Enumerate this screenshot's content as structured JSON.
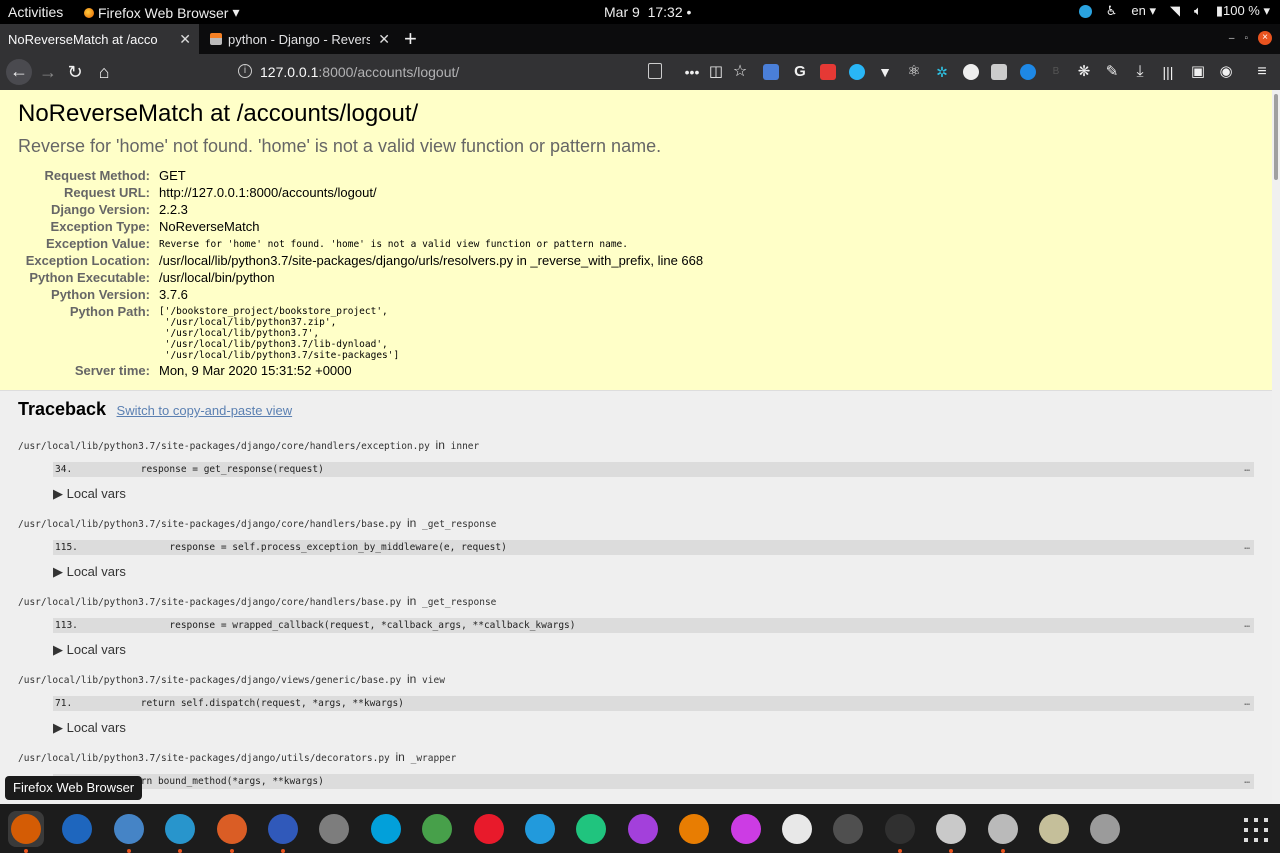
{
  "topbar": {
    "activities": "Activities",
    "app_name": "Firefox Web Browser",
    "date": "Mar 9",
    "time": "17:32",
    "language": "en",
    "battery": "100 %"
  },
  "tabs": [
    {
      "title": "NoReverseMatch at /accounts/logout/",
      "active": true
    },
    {
      "title": "python - Django - Reverse for 'home' not found",
      "active": false
    }
  ],
  "navbar": {
    "url_host": "127.0.0.1",
    "url_rest": ":8000/accounts/logout/"
  },
  "error": {
    "title": "NoReverseMatch at /accounts/logout/",
    "subtitle": "Reverse for 'home' not found. 'home' is not a valid view function or pattern name.",
    "meta": [
      {
        "label": "Request Method:",
        "value": "GET"
      },
      {
        "label": "Request URL:",
        "value": "http://127.0.0.1:8000/accounts/logout/"
      },
      {
        "label": "Django Version:",
        "value": "2.2.3"
      },
      {
        "label": "Exception Type:",
        "value": "NoReverseMatch"
      },
      {
        "label": "Exception Value:",
        "value": "Reverse for 'home' not found. 'home' is not a valid view function or pattern name."
      },
      {
        "label": "Exception Location:",
        "value": "/usr/local/lib/python3.7/site-packages/django/urls/resolvers.py in _reverse_with_prefix, line 668"
      },
      {
        "label": "Python Executable:",
        "value": "/usr/local/bin/python"
      },
      {
        "label": "Python Version:",
        "value": "3.7.6"
      },
      {
        "label": "Python Path:",
        "value": "['/bookstore_project/bookstore_project',\n '/usr/local/lib/python37.zip',\n '/usr/local/lib/python3.7',\n '/usr/local/lib/python3.7/lib-dynload',\n '/usr/local/lib/python3.7/site-packages']"
      },
      {
        "label": "Server time:",
        "value": "Mon, 9 Mar 2020 15:31:52 +0000"
      }
    ]
  },
  "traceback": {
    "heading": "Traceback",
    "toggle": "Switch to copy-and-paste view",
    "in_word": "in",
    "local_vars": "▶ Local vars",
    "frames": [
      {
        "file": "/usr/local/lib/python3.7/site-packages/django/core/handlers/exception.py",
        "func": "inner",
        "line": "34.            response = get_response(request)"
      },
      {
        "file": "/usr/local/lib/python3.7/site-packages/django/core/handlers/base.py",
        "func": "_get_response",
        "line": "115.                response = self.process_exception_by_middleware(e, request)"
      },
      {
        "file": "/usr/local/lib/python3.7/site-packages/django/core/handlers/base.py",
        "func": "_get_response",
        "line": "113.                response = wrapped_callback(request, *callback_args, **callback_kwargs)"
      },
      {
        "file": "/usr/local/lib/python3.7/site-packages/django/views/generic/base.py",
        "func": "view",
        "line": "71.            return self.dispatch(request, *args, **kwargs)"
      },
      {
        "file": "/usr/local/lib/python3.7/site-packages/django/utils/decorators.py",
        "func": "_wrapper",
        "line": "45.        return bound_method(*args, **kwargs)"
      }
    ],
    "ellipsis": "…"
  },
  "tooltip": "Firefox Web Browser",
  "dock": [
    {
      "icon": "firefox-icon",
      "color": "#e66000",
      "running": true
    },
    {
      "icon": "thunderbird-icon",
      "color": "#1f6fd0",
      "running": false
    },
    {
      "icon": "files-icon",
      "color": "#4a90d9",
      "running": true
    },
    {
      "icon": "telegram-icon",
      "color": "#2aa3e0",
      "running": true
    },
    {
      "icon": "postman-icon",
      "color": "#f06527",
      "running": true
    },
    {
      "icon": "simplenote-icon",
      "color": "#3361cc",
      "running": true
    },
    {
      "icon": "settings-icon",
      "color": "#888888",
      "running": false
    },
    {
      "icon": "skype-icon",
      "color": "#00aff0",
      "running": false
    },
    {
      "icon": "chrome-icon",
      "color": "#4caf50",
      "running": false
    },
    {
      "icon": "opera-icon",
      "color": "#ff1b2d",
      "running": false
    },
    {
      "icon": "vscode-icon",
      "color": "#23a9f2",
      "running": false
    },
    {
      "icon": "pycharm-icon",
      "color": "#21d789",
      "running": false
    },
    {
      "icon": "phpstorm-icon",
      "color": "#b345f1",
      "running": false
    },
    {
      "icon": "vlc-icon",
      "color": "#ff8800",
      "running": false
    },
    {
      "icon": "gem-icon",
      "color": "#e040fb",
      "running": false
    },
    {
      "icon": "music-icon",
      "color": "#ffffff",
      "running": false
    },
    {
      "icon": "system-monitor-icon",
      "color": "#555555",
      "running": false
    },
    {
      "icon": "terminal-icon",
      "color": "#333333",
      "running": true
    },
    {
      "icon": "lifebuoy-icon",
      "color": "#dddddd",
      "running": true
    },
    {
      "icon": "image-viewer-icon",
      "color": "#cccccc",
      "running": true
    },
    {
      "icon": "notes-icon",
      "color": "#d8d2a8",
      "running": false
    },
    {
      "icon": "usb-drive-icon",
      "color": "#aaaaaa",
      "running": false
    }
  ]
}
